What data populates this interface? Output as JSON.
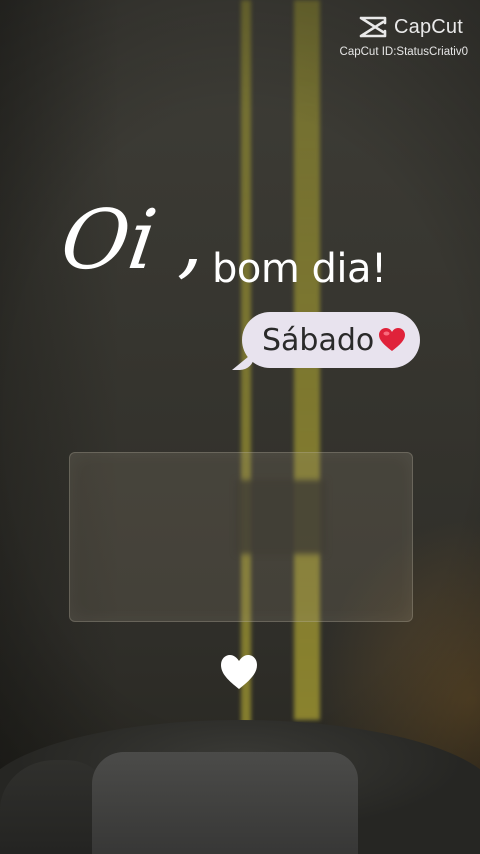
{
  "watermark": {
    "brand": "CapCut",
    "id_text": "CapCut ID:StatusCriativ0"
  },
  "greeting": {
    "oi": "Oi",
    "comma": ",",
    "bom_dia": "bom dia!"
  },
  "day_bubble": {
    "text": "Sábado",
    "emoji": "red-heart-icon"
  },
  "colors": {
    "text": "#ffffff",
    "bubble_bg": "#e8e3ee",
    "heart_red": "#e0223a",
    "light_beam": "#a9a13a"
  },
  "icons": [
    "capcut-logo-icon",
    "red-heart-icon",
    "white-heart-icon"
  ]
}
